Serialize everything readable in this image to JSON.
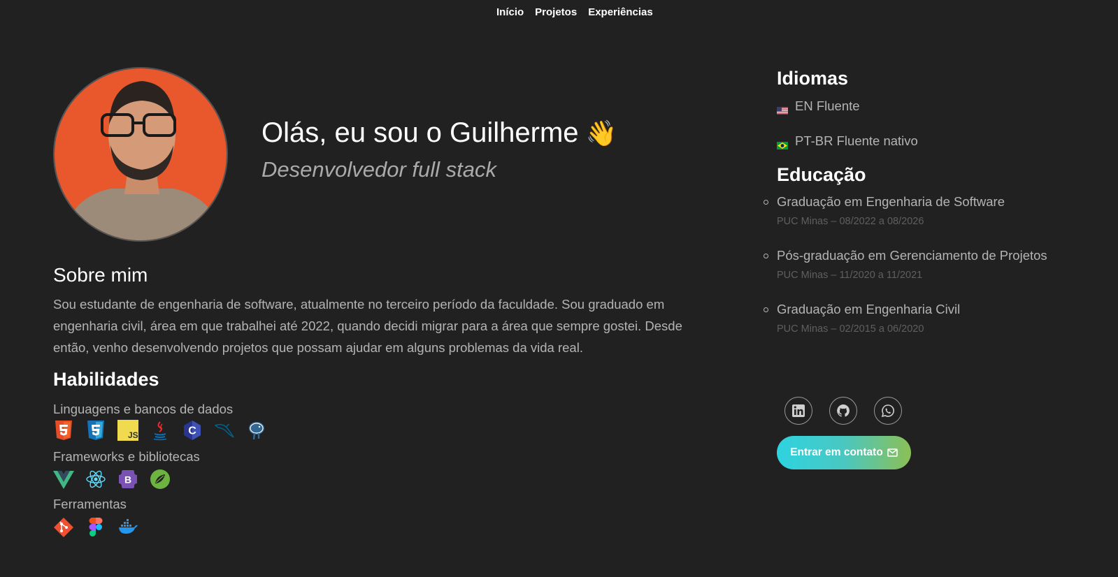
{
  "nav": {
    "items": [
      "Início",
      "Projetos",
      "Experiências"
    ]
  },
  "hero": {
    "greeting": "Olás, eu sou o Guilherme",
    "wave_emoji": "👋",
    "role": "Desenvolvedor full stack"
  },
  "about": {
    "title": "Sobre mim",
    "text": "Sou estudante de engenharia de software, atualmente no terceiro período da faculdade. Sou graduado em engenharia civil, área em que trabalhei até 2022, quando decidi migrar para a área que sempre gostei. Desde então, venho desenvolvendo projetos que possam ajudar em alguns problemas da vida real."
  },
  "skills": {
    "title": "Habilidades",
    "categories": [
      {
        "label": "Linguagens e bancos de dados",
        "icons": [
          "html5-icon",
          "css3-icon",
          "javascript-icon",
          "java-icon",
          "c-icon",
          "mysql-icon",
          "postgresql-icon"
        ]
      },
      {
        "label": "Frameworks e bibliotecas",
        "icons": [
          "vue-icon",
          "react-icon",
          "bootstrap-icon",
          "spring-icon"
        ]
      },
      {
        "label": "Ferramentas",
        "icons": [
          "git-icon",
          "figma-icon",
          "docker-icon"
        ]
      }
    ]
  },
  "languages": {
    "title": "Idiomas",
    "items": [
      "EN Fluente",
      "PT-BR Fluente nativo"
    ]
  },
  "education": {
    "title": "Educação",
    "items": [
      {
        "degree": "Graduação em Engenharia de Software",
        "meta": "PUC Minas – 08/2022 a 08/2026"
      },
      {
        "degree": "Pós-graduação em Gerenciamento de Projetos",
        "meta": "PUC Minas – 11/2020 a 11/2021"
      },
      {
        "degree": "Graduação em Engenharia Civil",
        "meta": "PUC Minas – 02/2015 a 06/2020"
      }
    ]
  },
  "socials": [
    "linkedin-icon",
    "github-icon",
    "whatsapp-icon"
  ],
  "contact": {
    "label": "Entrar em contato"
  },
  "colors": {
    "background": "#212121",
    "muted_text": "#b4b4b4",
    "avatar_bg": "#e8582c",
    "button_gradient": [
      "#2ed3e0",
      "#8cbf55"
    ]
  }
}
